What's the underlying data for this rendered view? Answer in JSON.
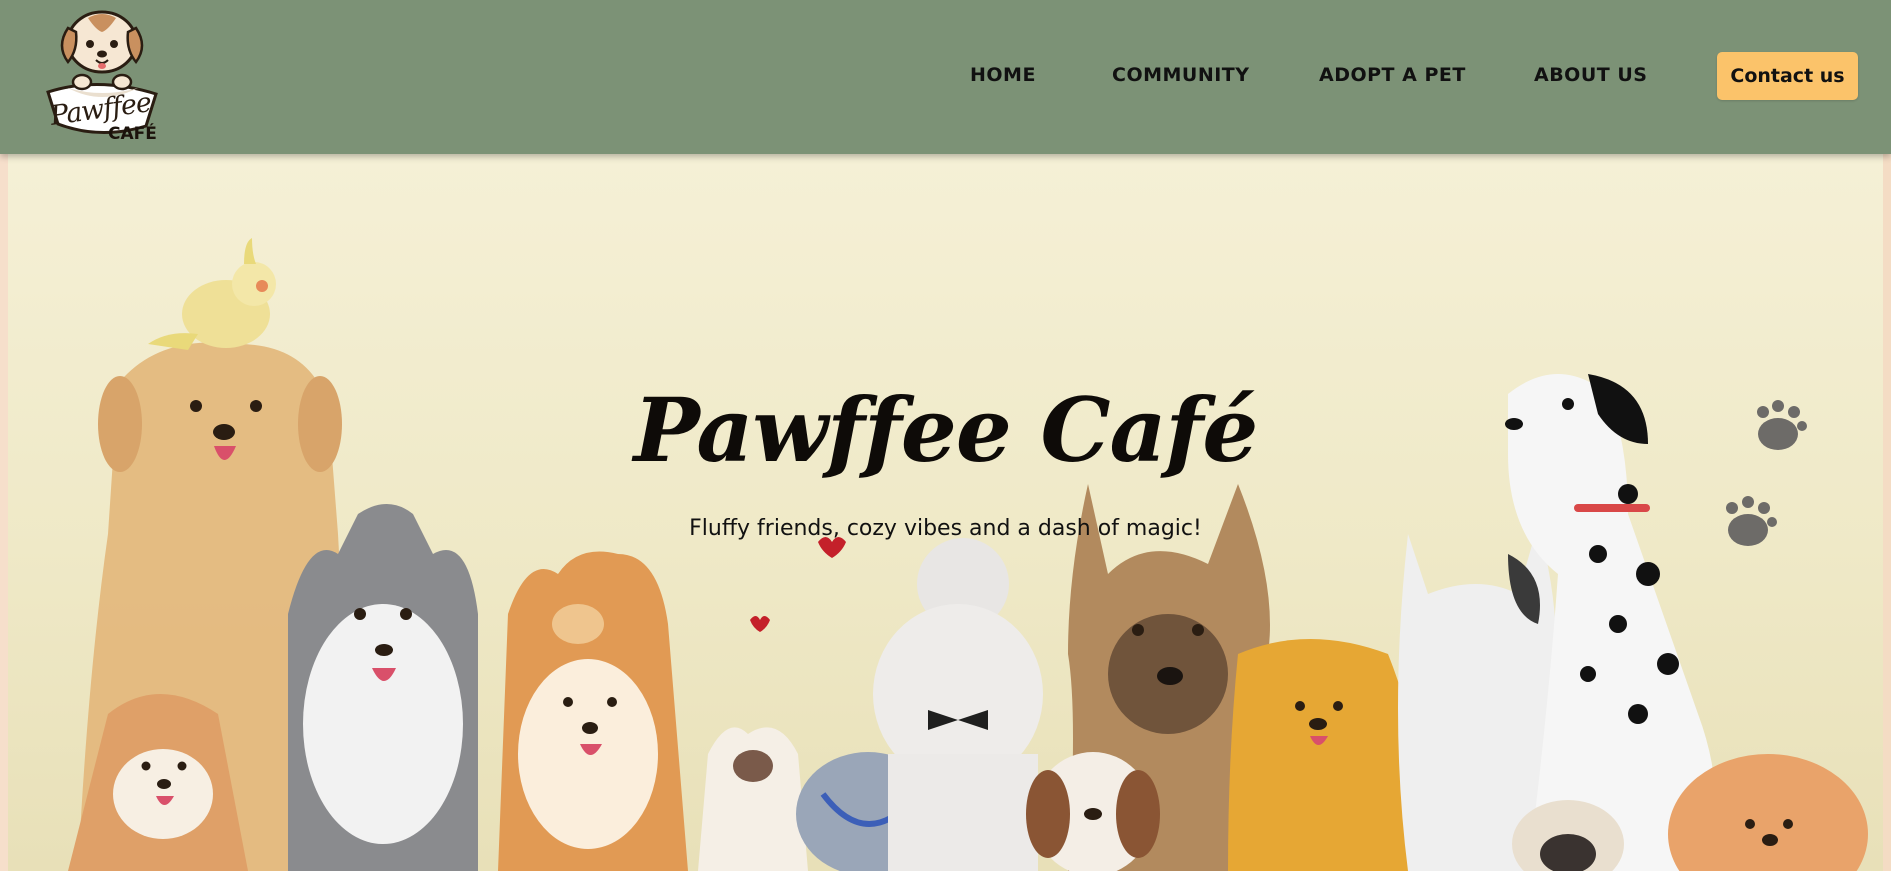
{
  "brand": {
    "logo_text": "Pawffee",
    "logo_sub": "CAFÉ"
  },
  "nav": {
    "items": [
      {
        "label": "HOME"
      },
      {
        "label": "COMMUNITY"
      },
      {
        "label": "ADOPT A PET"
      },
      {
        "label": "ABOUT US"
      }
    ],
    "contact_label": "Contact us"
  },
  "hero": {
    "title": "Pawffee Café",
    "subtitle": "Fluffy friends, cozy vibes and a dash of magic!"
  },
  "colors": {
    "navbar": "#7c9276",
    "button": "#fbc36a",
    "hero_bg": "#f3ecd0"
  }
}
